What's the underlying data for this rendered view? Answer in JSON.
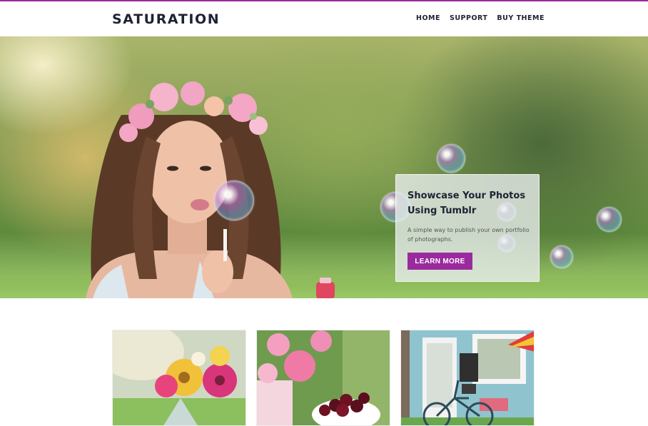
{
  "site": {
    "brand": "SATURATION",
    "accent_color": "#9b2a9e"
  },
  "nav": {
    "items": [
      {
        "label": "HOME"
      },
      {
        "label": "SUPPORT"
      },
      {
        "label": "BUY THEME"
      }
    ]
  },
  "hero": {
    "title": "Showcase Your Photos Using Tumblr",
    "description": "A simple way to publish your own portfolio of photographs.",
    "button_label": "LEARN MORE"
  },
  "thumbnails": [
    {
      "subject": "flower-bouquet-in-vase"
    },
    {
      "subject": "pink-flowers-and-cherries"
    },
    {
      "subject": "storefront-with-bicycle"
    }
  ]
}
